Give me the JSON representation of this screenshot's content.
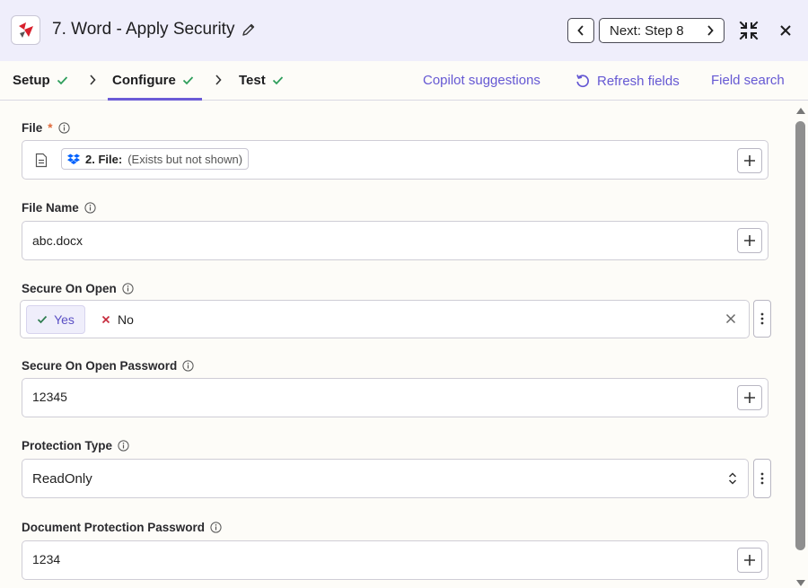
{
  "header": {
    "title": "7. Word - Apply Security",
    "next_label": "Next: Step 8"
  },
  "tabs": {
    "items": [
      {
        "label": "Setup",
        "done": true
      },
      {
        "label": "Configure",
        "done": true,
        "active": true
      },
      {
        "label": "Test",
        "done": true
      }
    ],
    "copilot": "Copilot suggestions",
    "refresh": "Refresh fields",
    "field_search": "Field search"
  },
  "fields": {
    "file": {
      "label": "File",
      "required_mark": "*",
      "chip_title": "2. File:",
      "chip_detail": "(Exists but not shown)"
    },
    "file_name": {
      "label": "File Name",
      "value": "abc.docx"
    },
    "secure_on_open": {
      "label": "Secure On Open",
      "yes": "Yes",
      "no": "No",
      "selected": "Yes"
    },
    "secure_on_open_password": {
      "label": "Secure On Open Password",
      "value": "12345"
    },
    "protection_type": {
      "label": "Protection Type",
      "value": "ReadOnly"
    },
    "document_protection_password": {
      "label": "Document Protection Password",
      "value": "1234"
    }
  },
  "colors": {
    "accent": "#6558d3",
    "check": "#2e9e5b",
    "required": "#e0693a",
    "dropbox": "#0061fe",
    "brand_red": "#d8202c"
  }
}
